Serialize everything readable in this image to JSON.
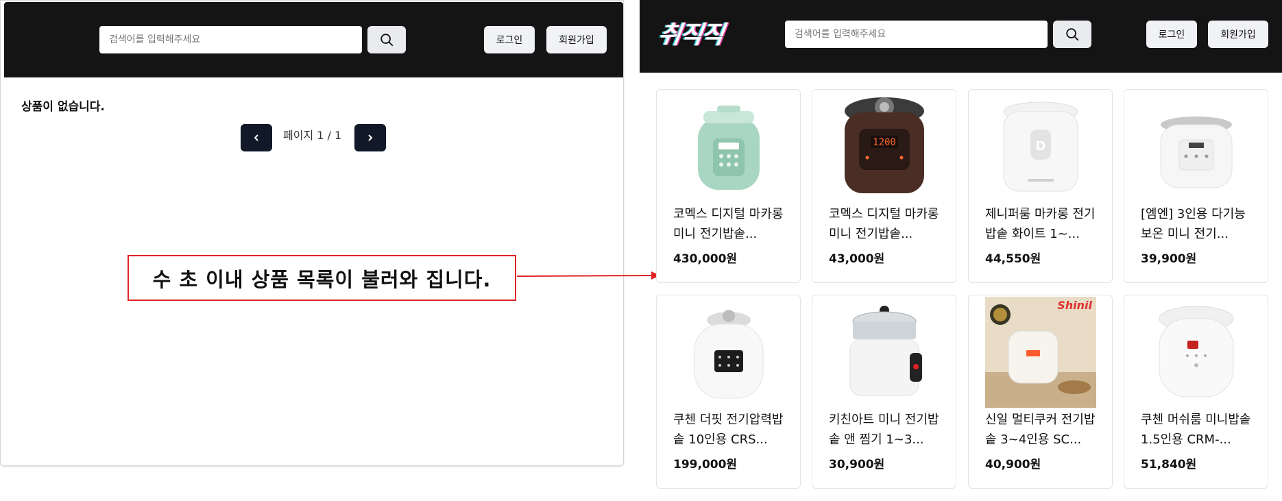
{
  "left": {
    "search": {
      "placeholder": "검색어를 입력해주세요"
    },
    "login_label": "로그인",
    "signup_label": "회원가입",
    "empty_message": "상품이 없습니다.",
    "pagination": {
      "prev": "‹",
      "next": "›",
      "info": "페이지 1 / 1"
    }
  },
  "annotation": {
    "text": "수 초 이내 상품 목록이 불러와 집니다.",
    "border_color": "#e02424"
  },
  "right": {
    "logo": "취직직",
    "search": {
      "placeholder": "검색어를 입력해주세요"
    },
    "login_label": "로그인",
    "signup_label": "회원가입",
    "products": [
      {
        "name": "코멕스 디지털 마카롱 미니 전기밥솥...",
        "price": "430,000원",
        "image": "mint-rice-cooker"
      },
      {
        "name": "코멕스 디지털 마카롱 미니 전기밥솥...",
        "price": "43,000원",
        "image": "dark-pressure-cooker"
      },
      {
        "name": "제니퍼룸 마카롱 전기밥솥 화이트 1~...",
        "price": "44,550원",
        "image": "white-tall-cooker"
      },
      {
        "name": "[엠엔] 3인용 다기능 보온 미니 전기...",
        "price": "39,900원",
        "image": "white-mini-cooker"
      },
      {
        "name": "쿠첸 더핏 전기압력밥솥 10인용 CRS...",
        "price": "199,000원",
        "image": "white-pressure-cooker"
      },
      {
        "name": "키친아트 미니 전기밥솥 앤 찜기 1~3...",
        "price": "30,900원",
        "image": "steamer-cooker"
      },
      {
        "name": "신일 멀티쿠커 전기밥솥 3~4인용 SC...",
        "price": "40,900원",
        "image": "multi-cooker-photo"
      },
      {
        "name": "쿠첸 머쉬룸 미니밥솥 1.5인용 CRM-...",
        "price": "51,840원",
        "image": "mushroom-cooker"
      }
    ]
  },
  "colors": {
    "header_bg": "#141414",
    "page_btn": "#111827",
    "accent_red": "#e02424"
  }
}
